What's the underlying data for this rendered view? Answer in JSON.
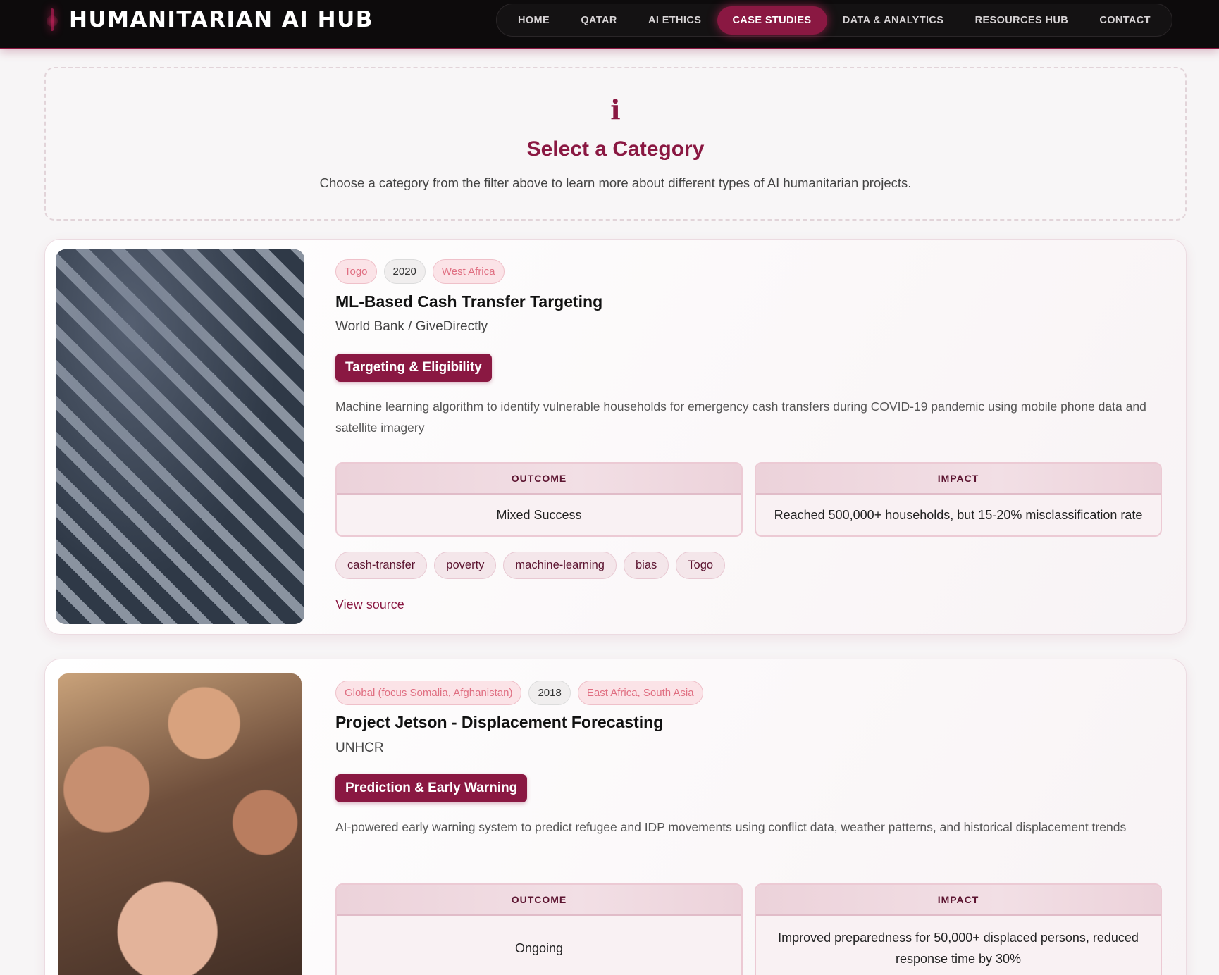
{
  "header": {
    "brand": "HUMANITARIAN AI HUB",
    "nav": [
      {
        "label": "HOME",
        "active": false
      },
      {
        "label": "QATAR",
        "active": false
      },
      {
        "label": "AI ETHICS",
        "active": false
      },
      {
        "label": "CASE STUDIES",
        "active": true
      },
      {
        "label": "DATA & ANALYTICS",
        "active": false
      },
      {
        "label": "RESOURCES HUB",
        "active": false
      },
      {
        "label": "CONTACT",
        "active": false
      }
    ]
  },
  "category_prompt": {
    "icon": "i",
    "title": "Select a Category",
    "description": "Choose a category from the filter above to learn more about different types of AI humanitarian projects."
  },
  "cases": [
    {
      "location": "Togo",
      "year": "2020",
      "region": "West Africa",
      "title": "ML-Based Cash Transfer Targeting",
      "organization": "World Bank / GiveDirectly",
      "category": "Targeting & Eligibility",
      "description": "Machine learning algorithm to identify vulnerable households for emergency cash transfers during COVID-19 pandemic using mobile phone data and satellite imagery",
      "outcome_label": "OUTCOME",
      "outcome": "Mixed Success",
      "impact_label": "IMPACT",
      "impact": "Reached 500,000+ households, but 15-20% misclassification rate",
      "tags": [
        "cash-transfer",
        "poverty",
        "machine-learning",
        "bias",
        "Togo"
      ],
      "source_label": "View source"
    },
    {
      "location": "Global (focus Somalia, Afghanistan)",
      "year": "2018",
      "region": "East Africa, South Asia",
      "title": "Project Jetson - Displacement Forecasting",
      "organization": "UNHCR",
      "category": "Prediction & Early Warning",
      "description": "AI-powered early warning system to predict refugee and IDP movements using conflict data, weather patterns, and historical displacement trends",
      "outcome_label": "OUTCOME",
      "outcome": "Ongoing",
      "impact_label": "IMPACT",
      "impact": "Improved preparedness for 50,000+ displaced persons, reduced response time by 30%"
    }
  ],
  "colors": {
    "accent": "#8a1842",
    "header_bg": "#0d0b0c",
    "pill_text": "#e06f82"
  }
}
